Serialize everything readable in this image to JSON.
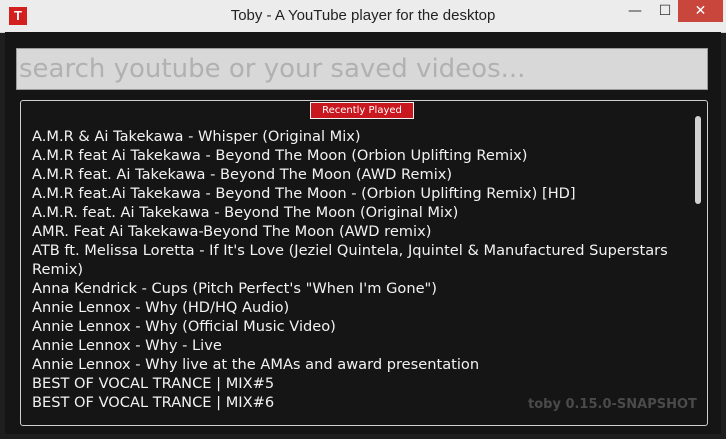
{
  "window": {
    "title": "Toby - A YouTube player for the desktop",
    "app_icon": "T",
    "min_icon": "—",
    "max_icon": "☐",
    "close_icon": "✕"
  },
  "search": {
    "placeholder": "search youtube or your saved videos..."
  },
  "panel": {
    "title": "Recently Played",
    "items": [
      "A.M.R & Ai Takekawa - Whisper (Original Mix)",
      "A.M.R feat Ai Takekawa - Beyond The Moon (Orbion Uplifting Remix)",
      "A.M.R feat. Ai Takekawa - Beyond The Moon (AWD Remix)",
      "A.M.R feat.Ai Takekawa - Beyond The Moon - (Orbion Uplifting Remix) [HD]",
      "A.M.R. feat. Ai Takekawa - Beyond The Moon (Original Mix)",
      "AMR. Feat Ai Takekawa-Beyond The Moon (AWD remix)",
      "ATB ft. Melissa Loretta - If It's Love (Jeziel Quintela, Jquintel & Manufactured Superstars Remix)",
      "Anna Kendrick - Cups (Pitch Perfect's \"When I'm Gone\")",
      "Annie Lennox - Why (HD/HQ Audio)",
      "Annie Lennox - Why (Official Music Video)",
      "Annie Lennox - Why - Live",
      "Annie Lennox - Why live at the AMAs and award presentation",
      "BEST OF VOCAL TRANCE | MIX#5",
      "BEST OF VOCAL TRANCE | MIX#6"
    ]
  },
  "footer": {
    "version": "toby 0.15.0-SNAPSHOT"
  }
}
